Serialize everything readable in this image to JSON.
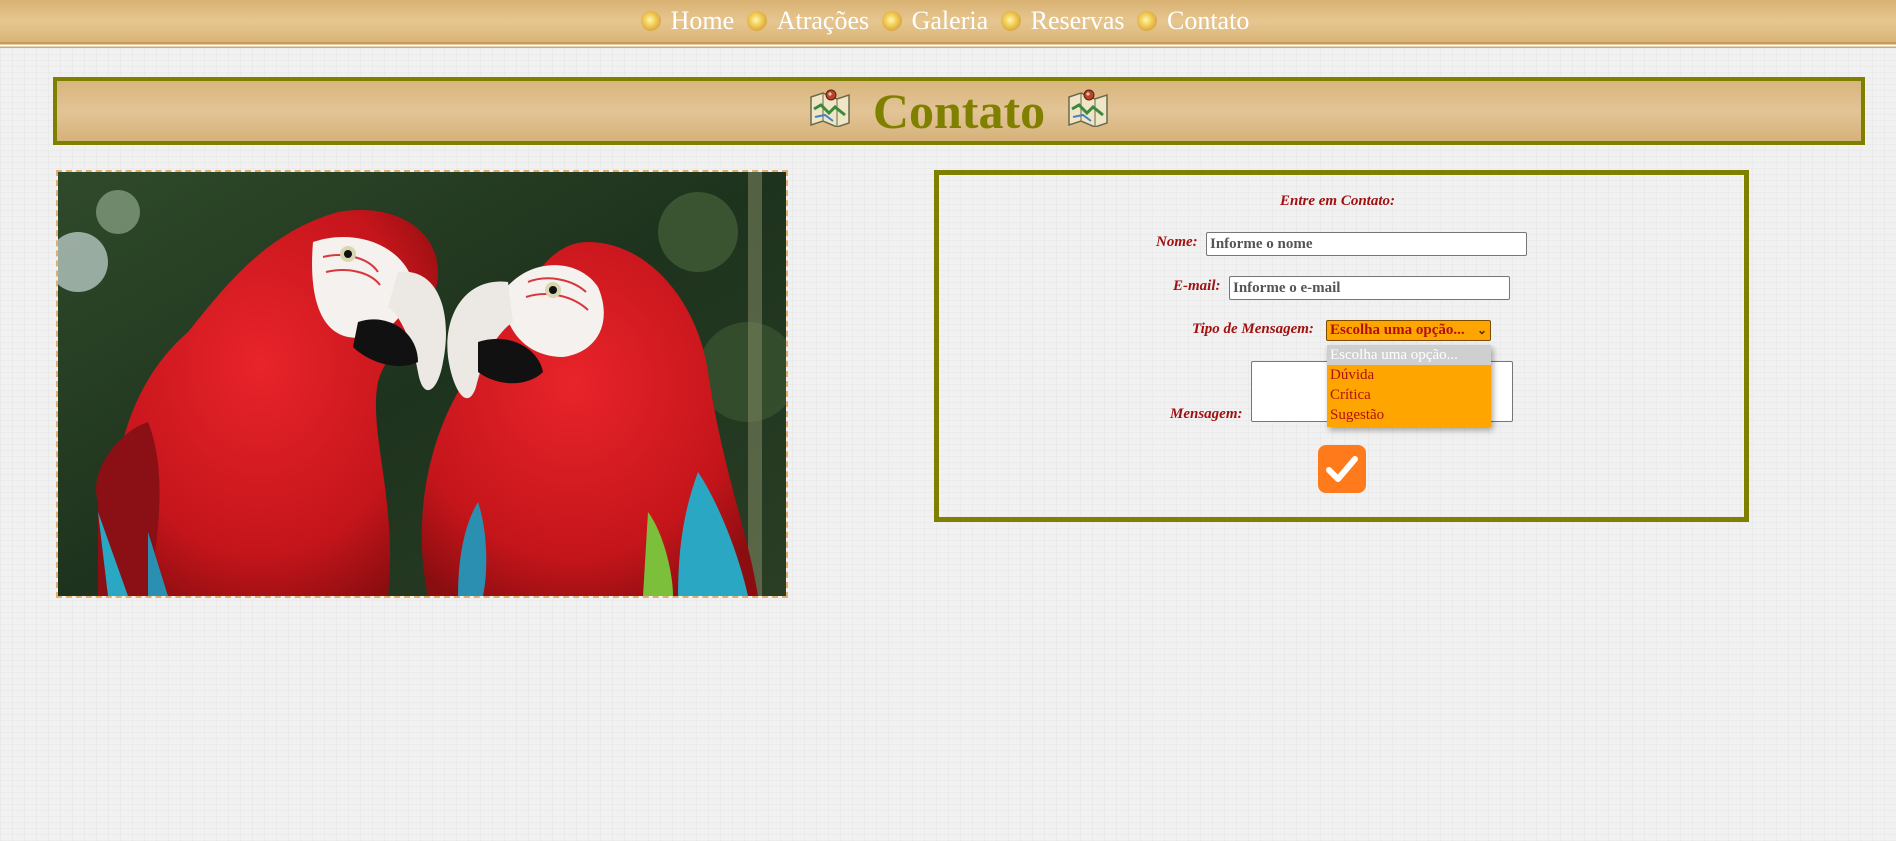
{
  "nav": {
    "items": [
      {
        "label": "Home"
      },
      {
        "label": "Atrações"
      },
      {
        "label": "Galeria"
      },
      {
        "label": "Reservas"
      },
      {
        "label": "Contato"
      }
    ],
    "bullet_icon": "sun-bullet-icon"
  },
  "page": {
    "title": "Contato",
    "title_icon": "map-icon"
  },
  "photo": {
    "subject": "two-red-macaws-image"
  },
  "form": {
    "heading": "Entre em Contato:",
    "name_label": "Nome:",
    "name_placeholder": "Informe o nome",
    "email_label": "E-mail:",
    "email_placeholder": "Informe o e-mail",
    "type_label": "Tipo de Mensagem:",
    "type_selected": "Escolha uma opção...",
    "type_options": [
      "Escolha uma opção...",
      "Dúvida",
      "Crítica",
      "Sugestão"
    ],
    "message_label": "Mensagem:",
    "submit_icon": "checkmark-icon"
  },
  "colors": {
    "olive": "#808000",
    "label_red": "#a01010",
    "select_orange": "#ffa500",
    "submit_orange": "#ff7a1a"
  }
}
